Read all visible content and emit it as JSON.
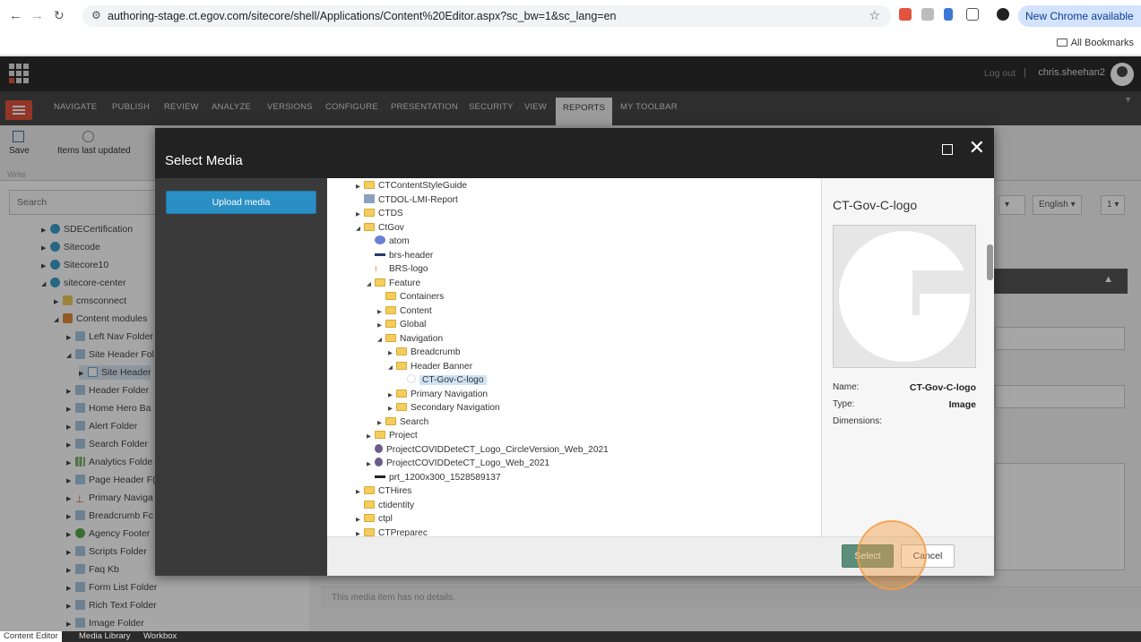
{
  "browser": {
    "url": "authoring-stage.ct.egov.com/sitecore/shell/Applications/Content%20Editor.aspx?sc_bw=1&sc_lang=en",
    "update_label": "New Chrome available",
    "bookmarks_label": "All Bookmarks"
  },
  "header": {
    "logout": "Log out",
    "separator": "|",
    "user": "chris.sheehan2"
  },
  "ribbon": {
    "tabs": [
      "NAVIGATE",
      "PUBLISH",
      "REVIEW",
      "ANALYZE",
      "VERSIONS",
      "CONFIGURE",
      "PRESENTATION",
      "SECURITY",
      "VIEW",
      "REPORTS",
      "MY TOOLBAR"
    ],
    "active_tab": "REPORTS",
    "save_label": "Save",
    "items_label": "Items last updated",
    "write_label": "Write"
  },
  "left_tree": {
    "search_placeholder": "Search",
    "items": [
      {
        "label": "SDECertification"
      },
      {
        "label": "Sitecode"
      },
      {
        "label": "Sitecore10"
      },
      {
        "label": "sitecore-center"
      },
      {
        "label": "cmsconnect"
      },
      {
        "label": "Content modules"
      },
      {
        "label": "Left Nav Folder"
      },
      {
        "label": "Site Header Fol"
      },
      {
        "label": "Site Header"
      },
      {
        "label": "Header Folder"
      },
      {
        "label": "Home Hero Ba"
      },
      {
        "label": "Alert Folder"
      },
      {
        "label": "Search Folder"
      },
      {
        "label": "Analytics Folde"
      },
      {
        "label": "Page Header F("
      },
      {
        "label": "Primary Naviga"
      },
      {
        "label": "Breadcrumb Fc"
      },
      {
        "label": "Agency Footer"
      },
      {
        "label": "Scripts Folder"
      },
      {
        "label": "Faq Kb"
      },
      {
        "label": "Form List Folder"
      },
      {
        "label": "Rich Text Folder"
      },
      {
        "label": "Image Folder"
      }
    ]
  },
  "right": {
    "language": "English",
    "version": "1",
    "no_details": "This media item has no details."
  },
  "bottom_tabs": [
    "Content Editor",
    "Media Library",
    "Workbox"
  ],
  "modal": {
    "title": "Select Media",
    "upload_label": "Upload media",
    "tree": [
      {
        "label": "CTContentStyleGuide"
      },
      {
        "label": "CTDOL-LMI-Report"
      },
      {
        "label": "CTDS"
      },
      {
        "label": "CtGov"
      },
      {
        "label": "atom"
      },
      {
        "label": "brs-header"
      },
      {
        "label": "BRS-logo"
      },
      {
        "label": "Feature"
      },
      {
        "label": "Containers"
      },
      {
        "label": "Content"
      },
      {
        "label": "Global"
      },
      {
        "label": "Navigation"
      },
      {
        "label": "Breadcrumb"
      },
      {
        "label": "Header Banner"
      },
      {
        "label": "CT-Gov-C-logo"
      },
      {
        "label": "Primary Navigation"
      },
      {
        "label": "Secondary Navigation"
      },
      {
        "label": "Search"
      },
      {
        "label": "Project"
      },
      {
        "label": "ProjectCOVIDDeteCT_Logo_CircleVersion_Web_2021"
      },
      {
        "label": "ProjectCOVIDDeteCT_Logo_Web_2021"
      },
      {
        "label": "prt_1200x300_1528589137"
      },
      {
        "label": "CTHires"
      },
      {
        "label": "ctidentity"
      },
      {
        "label": "ctpl"
      },
      {
        "label": "CTPreparec"
      }
    ],
    "preview": {
      "title": "CT-Gov-C-logo",
      "name_label": "Name:",
      "name_value": "CT-Gov-C-logo",
      "type_label": "Type:",
      "type_value": "Image",
      "dimensions_label": "Dimensions:"
    },
    "select_label": "Select",
    "cancel_label": "Cancel"
  }
}
